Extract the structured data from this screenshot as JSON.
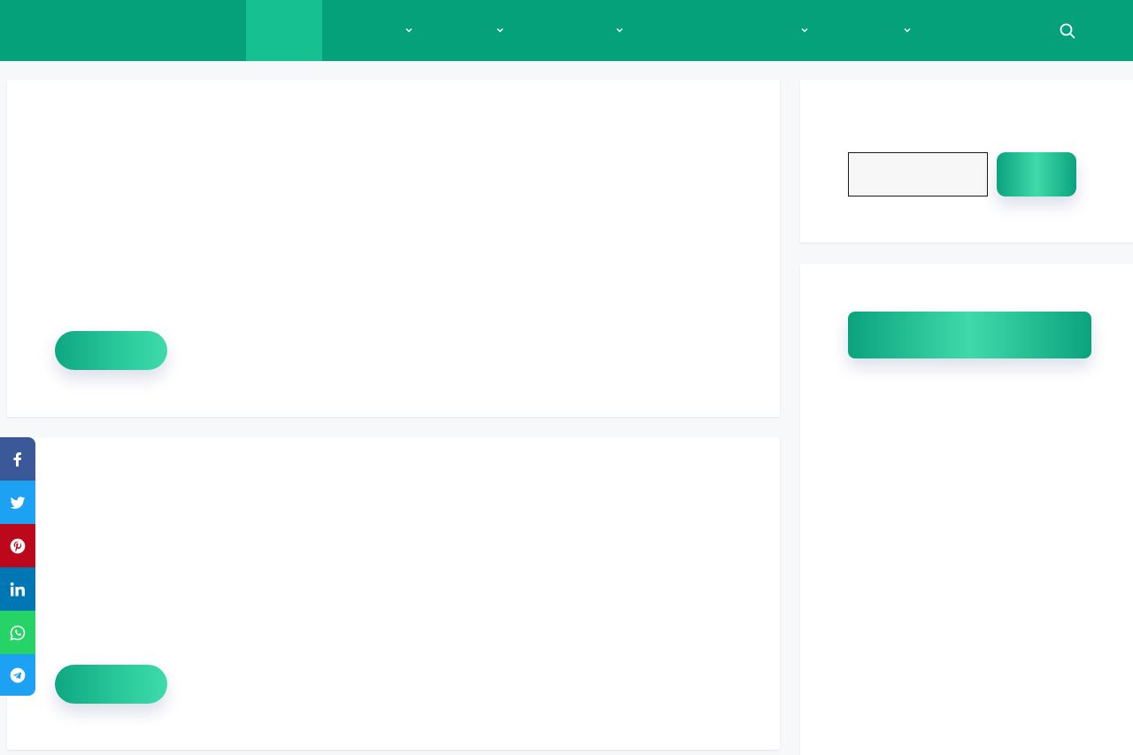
{
  "colors": {
    "header": "#05a17a",
    "nav_active": "#17c091",
    "page_background": "#f7f8f9",
    "card": "#ffffff",
    "accent_gradient_start": "#0aa37f",
    "accent_gradient_end": "#3fdaa9",
    "facebook": "#3b5998",
    "twitter": "#1da1f2",
    "pinterest": "#bd081c",
    "linkedin": "#0077b5",
    "whatsapp": "#25d366",
    "telegram": "#1da1f2"
  },
  "header": {
    "nav_dropdown_icons": [
      "chevron-down-icon",
      "chevron-down-icon",
      "chevron-down-icon",
      "chevron-down-icon",
      "chevron-down-icon"
    ],
    "search_icon": "search-icon"
  },
  "share_bar": {
    "items": [
      {
        "network": "facebook",
        "icon": "facebook-icon"
      },
      {
        "network": "twitter",
        "icon": "twitter-icon"
      },
      {
        "network": "pinterest",
        "icon": "pinterest-icon"
      },
      {
        "network": "linkedin",
        "icon": "linkedin-icon"
      },
      {
        "network": "whatsapp",
        "icon": "whatsapp-icon"
      },
      {
        "network": "telegram",
        "icon": "telegram-icon"
      }
    ]
  }
}
